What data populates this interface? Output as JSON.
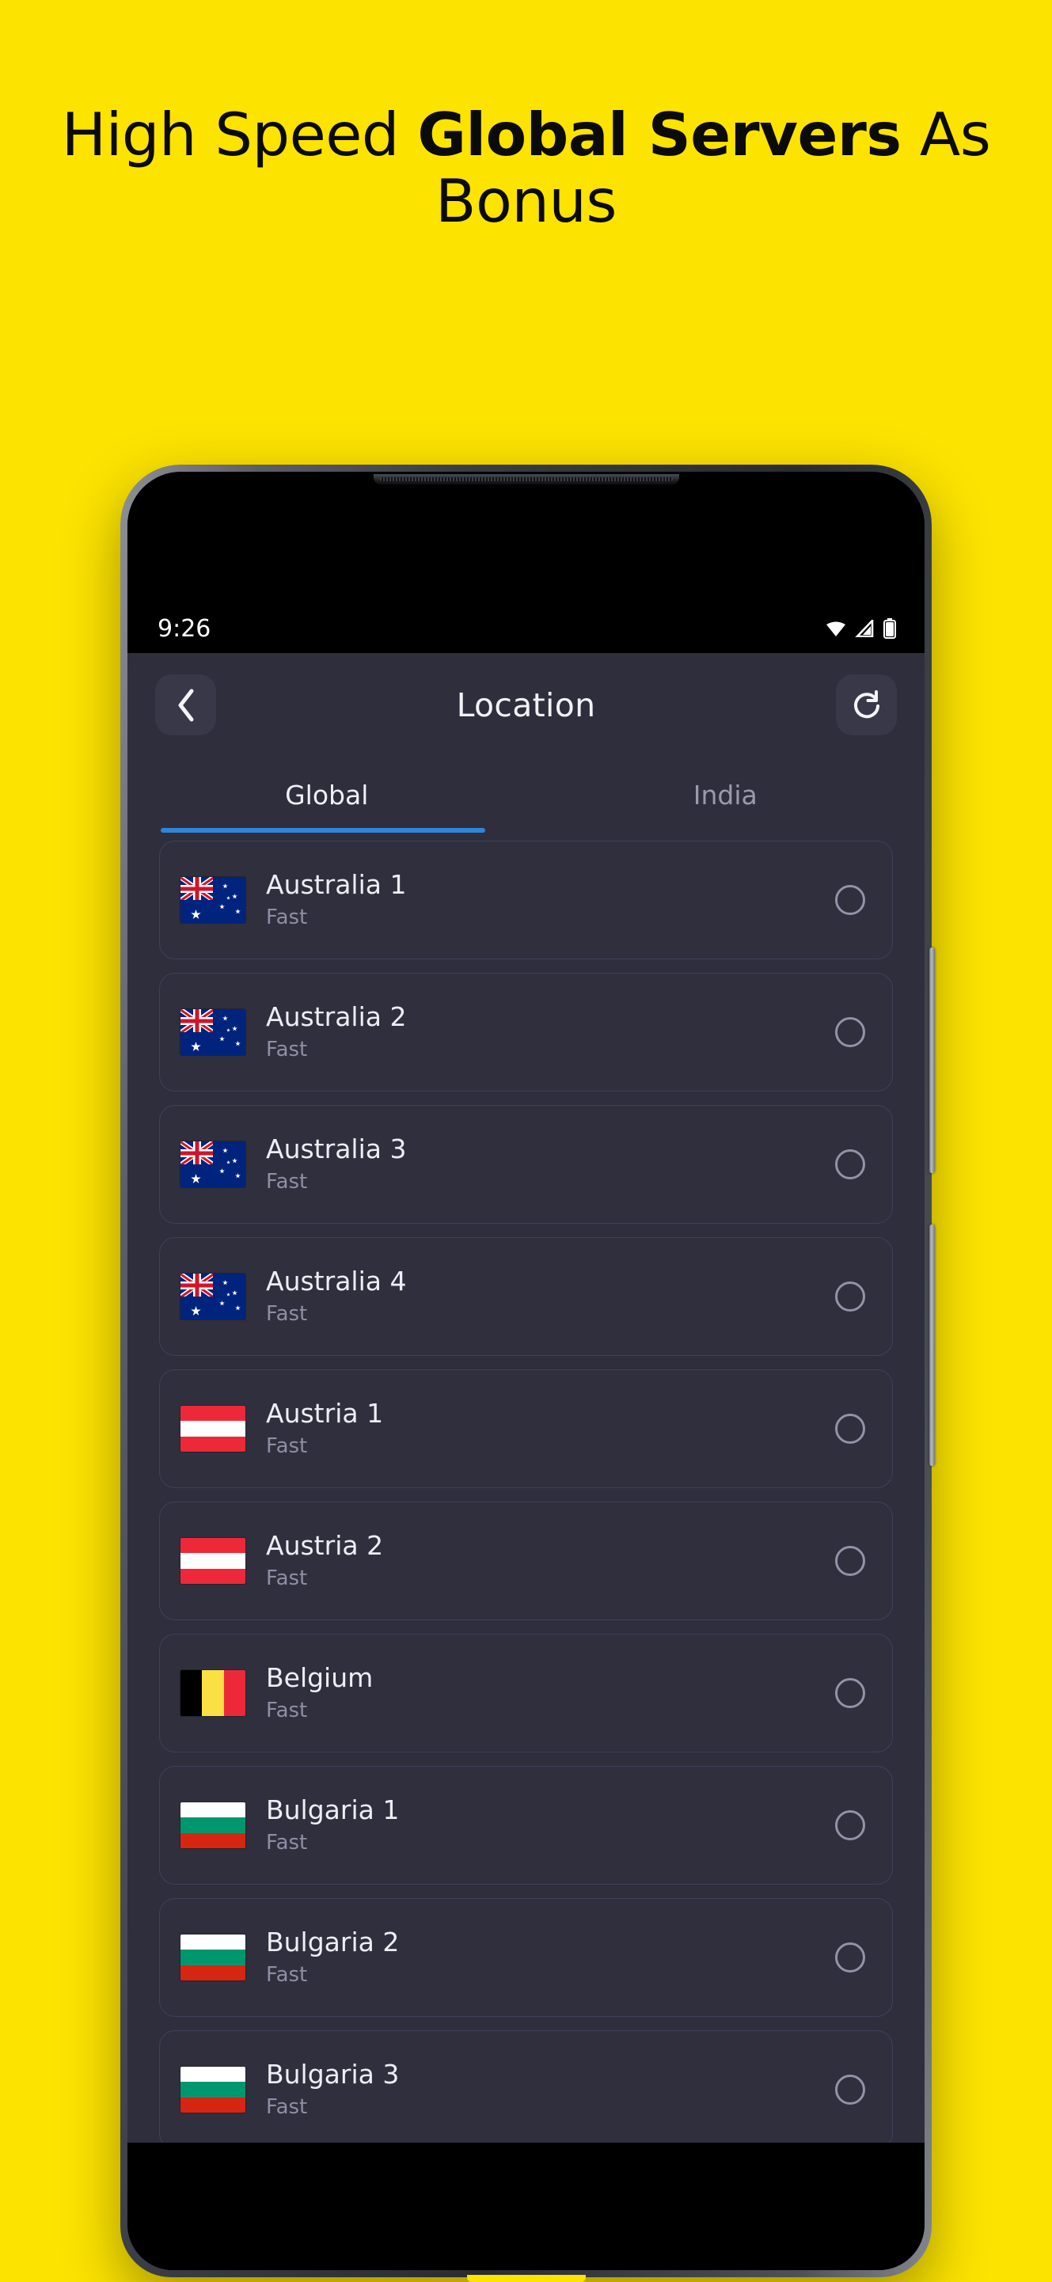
{
  "promo": {
    "headline_part1": "High Speed ",
    "headline_bold": "Global Servers",
    "headline_part2": " As Bonus",
    "background_color": "#FCE300"
  },
  "status_bar": {
    "time": "9:26",
    "icons": [
      "wifi-icon",
      "signal-icon",
      "battery-icon"
    ]
  },
  "app": {
    "background_color": "#2E2E3C",
    "accent_color": "#2E86D8",
    "header": {
      "back_label": "‹",
      "title": "Location",
      "refresh_label": "↻"
    },
    "tabs": [
      {
        "label": "Global",
        "active": true
      },
      {
        "label": "India",
        "active": false
      }
    ],
    "servers": [
      {
        "name": "Australia 1",
        "status": "Fast",
        "flag": "australia-flag",
        "selected": false
      },
      {
        "name": "Australia 2",
        "status": "Fast",
        "flag": "australia-flag",
        "selected": false
      },
      {
        "name": "Australia 3",
        "status": "Fast",
        "flag": "australia-flag",
        "selected": false
      },
      {
        "name": "Australia 4",
        "status": "Fast",
        "flag": "australia-flag",
        "selected": false
      },
      {
        "name": "Austria 1",
        "status": "Fast",
        "flag": "austria-flag",
        "selected": false
      },
      {
        "name": "Austria 2",
        "status": "Fast",
        "flag": "austria-flag",
        "selected": false
      },
      {
        "name": "Belgium",
        "status": "Fast",
        "flag": "belgium-flag",
        "selected": false
      },
      {
        "name": "Bulgaria 1",
        "status": "Fast",
        "flag": "bulgaria-flag",
        "selected": false
      },
      {
        "name": "Bulgaria 2",
        "status": "Fast",
        "flag": "bulgaria-flag",
        "selected": false
      },
      {
        "name": "Bulgaria 3",
        "status": "Fast",
        "flag": "bulgaria-flag",
        "selected": false
      }
    ]
  }
}
